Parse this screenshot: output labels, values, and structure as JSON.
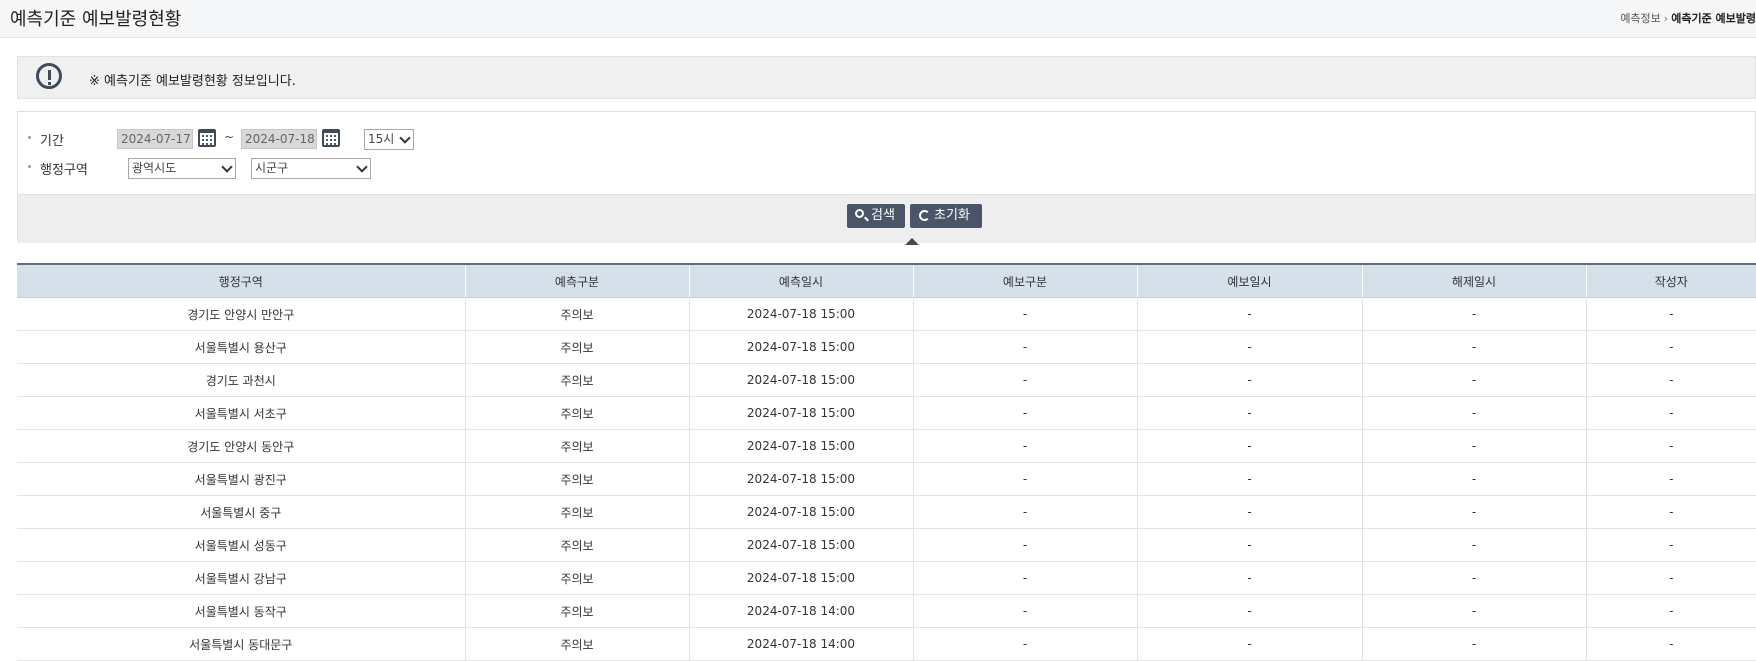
{
  "header": {
    "title": "예측기준 예보발령현황",
    "breadcrumb": [
      "예측정보",
      "예측기준 예보발령"
    ]
  },
  "notice": {
    "icon": "exclamation-circle-icon",
    "message": "※ 예측기준 예보발령현황 정보입니다."
  },
  "search": {
    "period_label": "기간",
    "start_date": "2024-07-17",
    "end_date": "2024-07-18",
    "tilde": "~",
    "hour": "15시",
    "region_label": "행정구역",
    "province_select": "광역시도",
    "district_select": "시군구",
    "search_button": "검색",
    "reset_button": "초기화"
  },
  "table": {
    "columns": [
      "행정구역",
      "예측구분",
      "예측일시",
      "예보구분",
      "예보일시",
      "해제일시",
      "작성자"
    ],
    "rows": [
      [
        "경기도 안양시 만안구",
        "주의보",
        "2024-07-18 15:00",
        "-",
        "-",
        "-",
        "-"
      ],
      [
        "서울특별시 용산구",
        "주의보",
        "2024-07-18 15:00",
        "-",
        "-",
        "-",
        "-"
      ],
      [
        "경기도 과천시",
        "주의보",
        "2024-07-18 15:00",
        "-",
        "-",
        "-",
        "-"
      ],
      [
        "서울특별시 서초구",
        "주의보",
        "2024-07-18 15:00",
        "-",
        "-",
        "-",
        "-"
      ],
      [
        "경기도 안양시 동안구",
        "주의보",
        "2024-07-18 15:00",
        "-",
        "-",
        "-",
        "-"
      ],
      [
        "서울특별시 광진구",
        "주의보",
        "2024-07-18 15:00",
        "-",
        "-",
        "-",
        "-"
      ],
      [
        "서울특별시 중구",
        "주의보",
        "2024-07-18 15:00",
        "-",
        "-",
        "-",
        "-"
      ],
      [
        "서울특별시 성동구",
        "주의보",
        "2024-07-18 15:00",
        "-",
        "-",
        "-",
        "-"
      ],
      [
        "서울특별시 강남구",
        "주의보",
        "2024-07-18 15:00",
        "-",
        "-",
        "-",
        "-"
      ],
      [
        "서울특별시 동작구",
        "주의보",
        "2024-07-18 14:00",
        "-",
        "-",
        "-",
        "-"
      ],
      [
        "서울특별시 동대문구",
        "주의보",
        "2024-07-18 14:00",
        "-",
        "-",
        "-",
        "-"
      ]
    ]
  },
  "colors": {
    "header_bg": "#d5e0eb",
    "button_bg": "#4a5568",
    "notice_bg": "#f0f0f0"
  }
}
